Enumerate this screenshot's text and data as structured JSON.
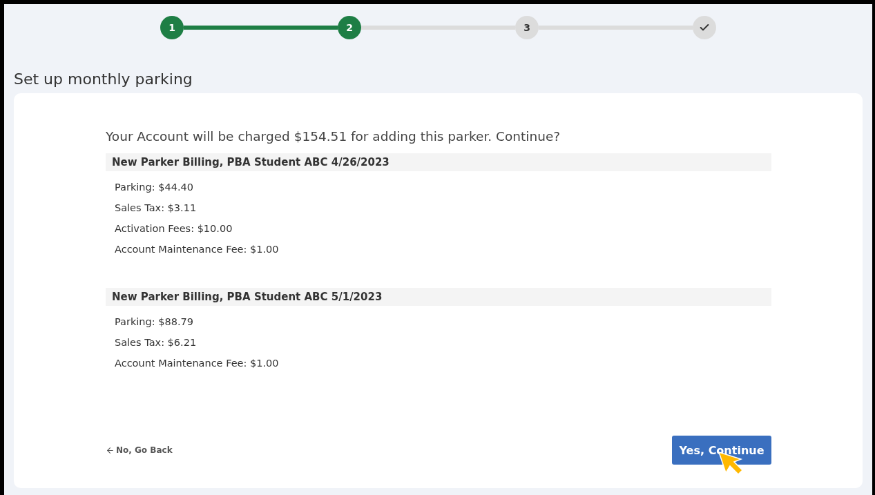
{
  "steps": [
    {
      "label": "1",
      "kind": "number",
      "done": true
    },
    {
      "label": "2",
      "kind": "number",
      "done": true
    },
    {
      "label": "3",
      "kind": "number",
      "done": false
    },
    {
      "kind": "check",
      "done": false
    }
  ],
  "page_title": "Set up monthly parking",
  "message": "Your Account will be charged $154.51 for adding this parker. Continue?",
  "billing_sections": [
    {
      "header": "New Parker Billing, PBA Student ABC 4/26/2023",
      "lines": [
        "Parking: $44.40",
        "Sales Tax: $3.11",
        "Activation Fees: $10.00",
        "Account Maintenance Fee: $1.00"
      ]
    },
    {
      "header": "New Parker Billing, PBA Student ABC 5/1/2023",
      "lines": [
        "Parking: $88.79",
        "Sales Tax: $6.21",
        "Account Maintenance Fee: $1.00"
      ]
    }
  ],
  "back_link": "No, Go Back",
  "continue_button": "Yes, Continue"
}
